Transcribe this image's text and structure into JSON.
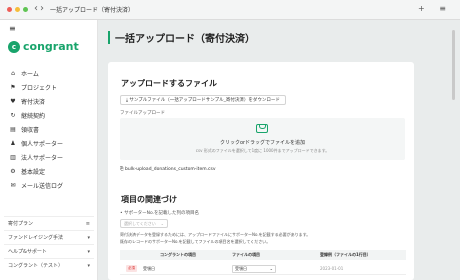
{
  "window": {
    "title": "一括アップロード（寄付決済）",
    "nav_back": "‹",
    "nav_forward": "›",
    "actions": "+ ≡"
  },
  "sidebar": {
    "logo_mark": "c",
    "logo_text": "congrant",
    "items": [
      {
        "icon": "home-icon",
        "glyph": "⌂",
        "label": "ホーム"
      },
      {
        "icon": "flag-icon",
        "glyph": "⚑",
        "label": "プロジェクト"
      },
      {
        "icon": "heart-icon",
        "glyph": "♥",
        "label": "寄付決済"
      },
      {
        "icon": "refresh-icon",
        "glyph": "↻",
        "label": "継続契約"
      },
      {
        "icon": "receipt-icon",
        "glyph": "▤",
        "label": "領収書"
      },
      {
        "icon": "person-icon",
        "glyph": "♟",
        "label": "個人サポーター"
      },
      {
        "icon": "building-icon",
        "glyph": "▥",
        "label": "法人サポーター"
      },
      {
        "icon": "gear-icon",
        "glyph": "⚙",
        "label": "基本設定"
      },
      {
        "icon": "mail-icon",
        "glyph": "✉",
        "label": "メール送信ログ"
      }
    ],
    "bottom": [
      {
        "label": "寄付プラン",
        "action": "≡"
      },
      {
        "label": "ファンドレイジング手法",
        "action": "▾"
      },
      {
        "label": "ヘルプ&サポート",
        "action": "▾"
      },
      {
        "label": "コングラント（テスト）",
        "action": "▾"
      }
    ]
  },
  "page": {
    "title": "一括アップロード（寄付決済）"
  },
  "upload": {
    "title": "アップロードするファイル",
    "sample_button": "⤓ サンプルファイル（一括アップロードサンプル_寄付決済）をダウンロード",
    "file_label": "ファイルアップロード",
    "dropzone_main": "クリックorドラッグでファイルを追加",
    "dropzone_sub": "csv 形式のファイルを選択して1度に 1000件までアップロードできます。",
    "file_name": "⎘ bulk-upload_donations_custom-item.csv"
  },
  "mapping": {
    "title": "項目の関連づけ",
    "supporter_label": "• サポーターNo.を記載した列の項目名",
    "select_placeholder": "選択してください",
    "select_chevron": "⌄",
    "help_line1": "寄付決済データを登録するためには、アップロードファイルにサポーターNo.を記載する必要があります。",
    "help_line2": "既存のレコードのサポーターNo.を記載してファイルの項目名を選択してください。",
    "columns": [
      "コングラントの項目",
      "ファイルの項目",
      "登録例（ファイルの1行目）"
    ],
    "rows": [
      {
        "badge": "必須",
        "item": "受領日",
        "file_item": "受領日",
        "example": "2023-01-01"
      }
    ]
  },
  "colors": {
    "accent": "#18a46b",
    "required": "#d33333"
  }
}
